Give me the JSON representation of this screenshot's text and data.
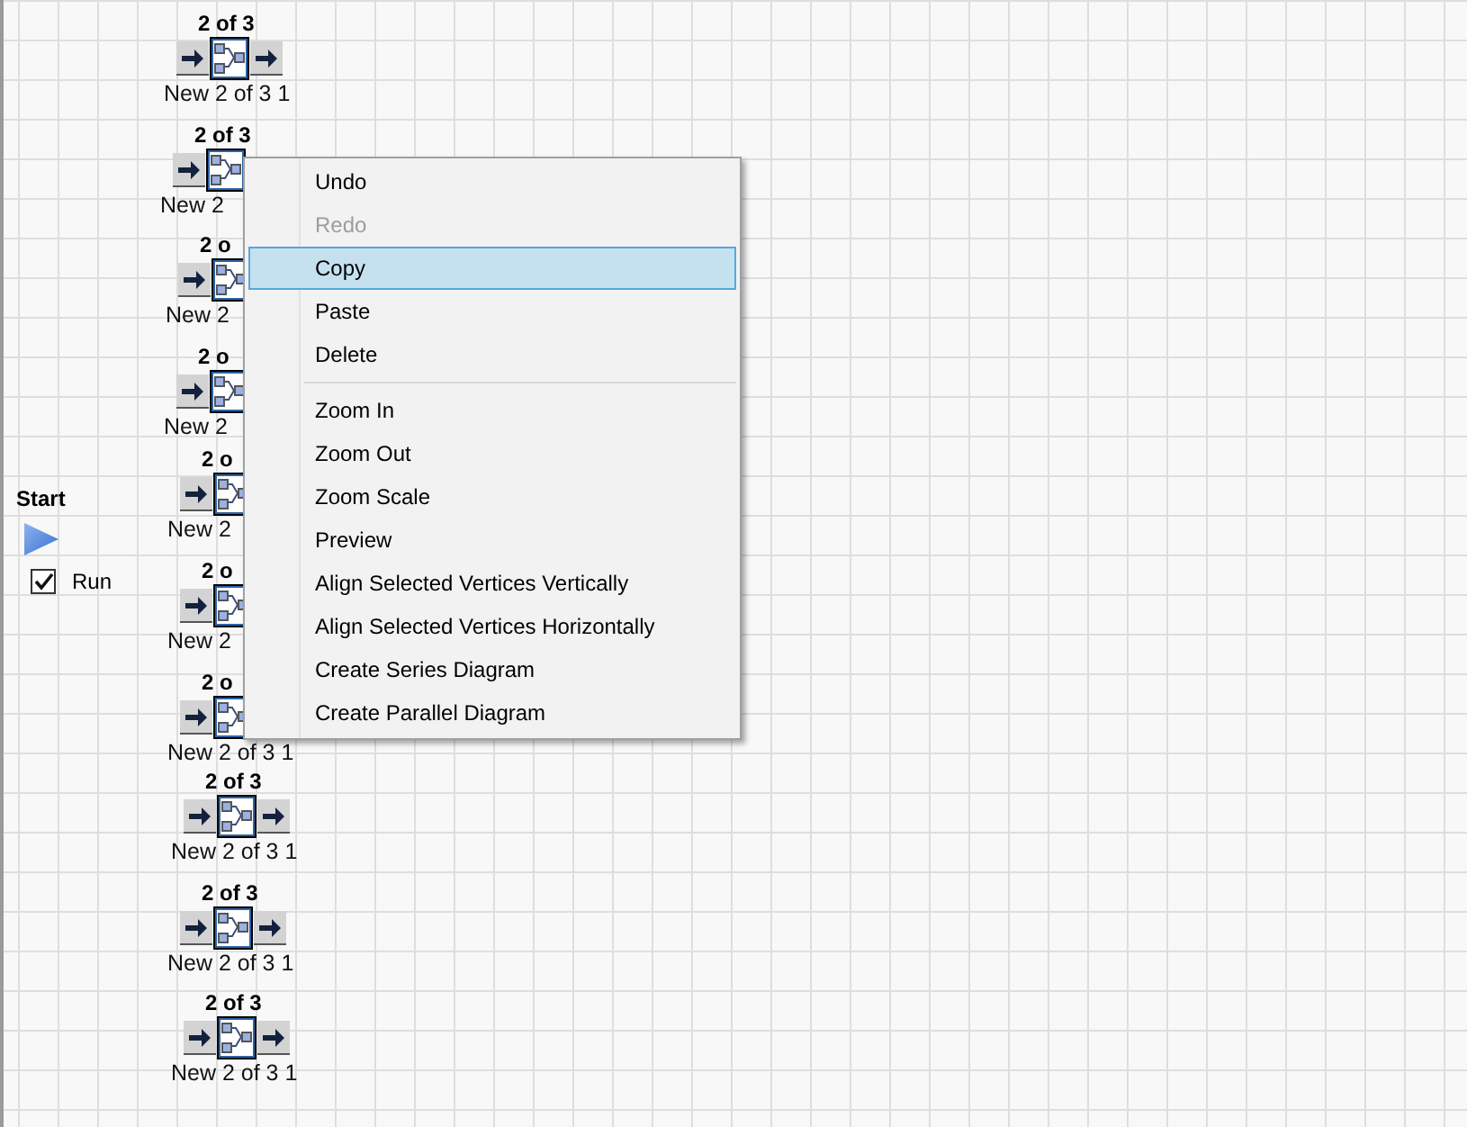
{
  "start": {
    "title": "Start",
    "run": {
      "label": "Run",
      "checked": true
    }
  },
  "nodes": [
    {
      "title": "2 of 3",
      "label": "New 2 of 3 1",
      "out_arrow": true
    },
    {
      "title": "2 of 3",
      "label": "New 2",
      "out_arrow": false
    },
    {
      "title": "2 o",
      "label": "New 2",
      "out_arrow": false
    },
    {
      "title": "2 o",
      "label": "New 2",
      "out_arrow": false
    },
    {
      "title": "2 o",
      "label": "New 2",
      "out_arrow": false
    },
    {
      "title": "2 o",
      "label": "New 2",
      "out_arrow": false
    },
    {
      "title": "2 o",
      "label": "New 2 of 3 1",
      "out_arrow": false
    },
    {
      "title": "2 of 3",
      "label": "New 2 of 3 1",
      "out_arrow": true
    },
    {
      "title": "2 of 3",
      "label": "New 2 of 3 1",
      "out_arrow": true
    },
    {
      "title": "2 of 3",
      "label": "New 2 of 3 1",
      "out_arrow": true
    }
  ],
  "context_menu": [
    {
      "kind": "item",
      "label": "Undo",
      "disabled": false,
      "selected": false
    },
    {
      "kind": "item",
      "label": "Redo",
      "disabled": true,
      "selected": false
    },
    {
      "kind": "item",
      "label": "Copy",
      "disabled": false,
      "selected": true
    },
    {
      "kind": "item",
      "label": "Paste",
      "disabled": false,
      "selected": false
    },
    {
      "kind": "item",
      "label": "Delete",
      "disabled": false,
      "selected": false
    },
    {
      "kind": "separator"
    },
    {
      "kind": "item",
      "label": "Zoom In",
      "disabled": false,
      "selected": false
    },
    {
      "kind": "item",
      "label": "Zoom Out",
      "disabled": false,
      "selected": false
    },
    {
      "kind": "item",
      "label": "Zoom Scale",
      "disabled": false,
      "selected": false
    },
    {
      "kind": "item",
      "label": "Preview",
      "disabled": false,
      "selected": false
    },
    {
      "kind": "item",
      "label": "Align Selected Vertices Vertically",
      "disabled": false,
      "selected": false
    },
    {
      "kind": "item",
      "label": "Align Selected Vertices Horizontally",
      "disabled": false,
      "selected": false
    },
    {
      "kind": "item",
      "label": "Create Series Diagram",
      "disabled": false,
      "selected": false
    },
    {
      "kind": "item",
      "label": "Create Parallel Diagram",
      "disabled": false,
      "selected": false
    }
  ]
}
